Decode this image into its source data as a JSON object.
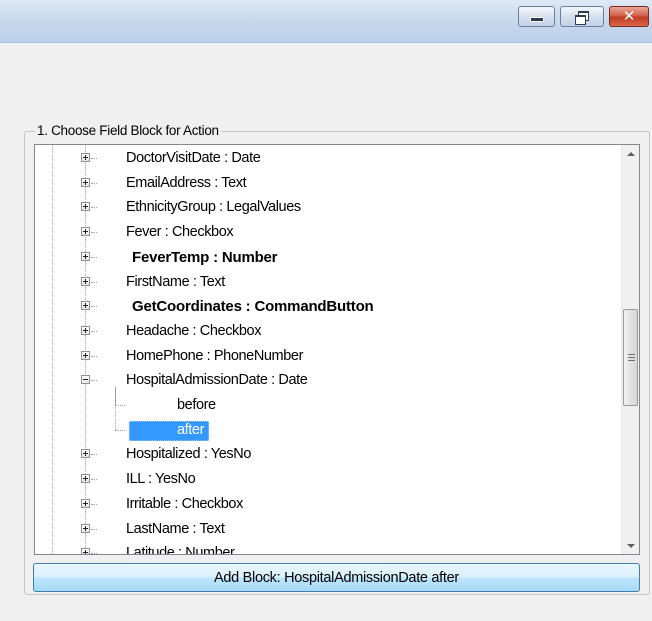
{
  "window": {
    "buttons": {
      "minimize_icon": "minimize-icon",
      "maximize_icon": "restore-icon",
      "close_icon": "close-icon",
      "close_glyph": "✕"
    }
  },
  "groupbox": {
    "label": "1. Choose Field Block for Action"
  },
  "tree": {
    "items": [
      {
        "label": "DoctorVisitDate : Date",
        "bold": false,
        "expanded": false
      },
      {
        "label": "EmailAddress : Text",
        "bold": false,
        "expanded": false
      },
      {
        "label": "EthnicityGroup : LegalValues",
        "bold": false,
        "expanded": false
      },
      {
        "label": "Fever : Checkbox",
        "bold": false,
        "expanded": false
      },
      {
        "label": "FeverTemp : Number",
        "bold": true,
        "expanded": false
      },
      {
        "label": "FirstName : Text",
        "bold": false,
        "expanded": false
      },
      {
        "label": "GetCoordinates : CommandButton",
        "bold": true,
        "expanded": false
      },
      {
        "label": "Headache : Checkbox",
        "bold": false,
        "expanded": false
      },
      {
        "label": "HomePhone : PhoneNumber",
        "bold": false,
        "expanded": false
      },
      {
        "label": "HospitalAdmissionDate : Date",
        "bold": false,
        "expanded": true,
        "children": [
          {
            "label": "before",
            "selected": false
          },
          {
            "label": "after",
            "selected": true
          }
        ]
      },
      {
        "label": "Hospitalized : YesNo",
        "bold": false,
        "expanded": false
      },
      {
        "label": "ILL : YesNo",
        "bold": false,
        "expanded": false
      },
      {
        "label": "Irritable : Checkbox",
        "bold": false,
        "expanded": false
      },
      {
        "label": "LastName : Text",
        "bold": false,
        "expanded": false
      },
      {
        "label": "Latitude : Number",
        "bold": false,
        "expanded": false
      }
    ],
    "scroll_position": 0.6
  },
  "add_button": {
    "label": "Add Block: HospitalAdmissionDate after"
  },
  "colors": {
    "selection": "#3399ff",
    "button_border": "#3c7fb1"
  }
}
